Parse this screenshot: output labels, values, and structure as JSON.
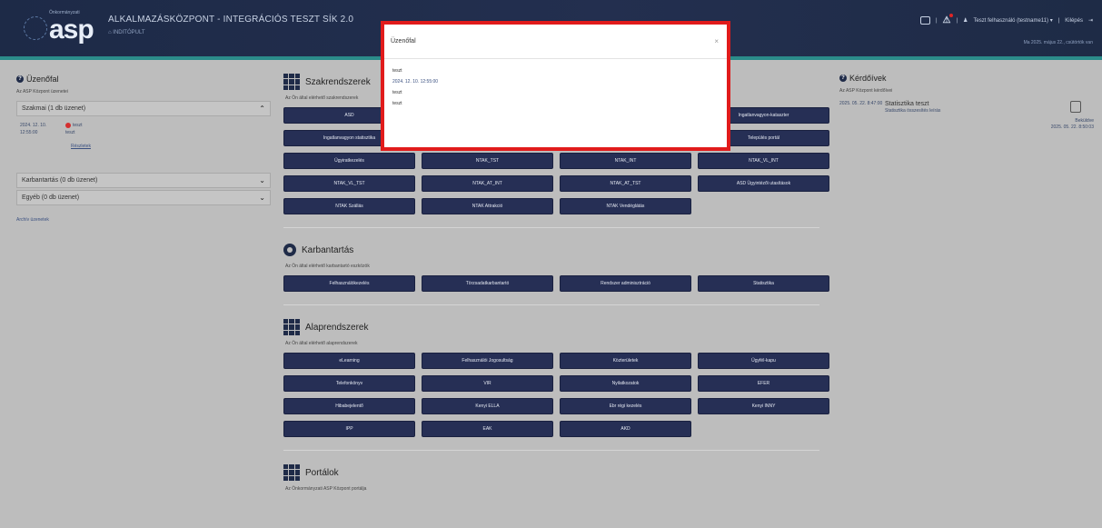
{
  "header": {
    "logo_small": "Önkormányzati",
    "logo_text": "asp",
    "title": "ALKALMAZÁSKÖZPONT - INTEGRÁCIÓS TESZT SÍK 2.0",
    "breadcrumb": "⌂ INDITÓPULT",
    "user": "Teszt felhasználó (testname11) ▾",
    "logout": "Kilépés",
    "date_line": "Ma 2025. május 22., csütörtök van"
  },
  "left": {
    "title": "Üzenőfal",
    "subtitle": "Az ASP Központ üzenetei",
    "acc1": "Szakmai (1 db üzenet)",
    "msg_date": "2024. 12. 10. 12:55:00",
    "msg_title": "teszt",
    "msg_body": "teszt",
    "details": "Részletek",
    "acc2": "Karbantartás (0 db üzenet)",
    "acc3": "Egyéb (0 db üzenet)",
    "archive": "Archív üzenetek"
  },
  "center": {
    "sec1_title": "Szakrendszerek",
    "sec1_sub": "Az Ön által elérhető szakrendszerek",
    "sec1_buttons": [
      "ASD",
      "",
      "",
      "Ingatlanvagyon-kataszter",
      "Ingatlanvagyon statisztika",
      "",
      "",
      "Település portál",
      "Ügyiratkezelés",
      "NTAK_TST",
      "NTAK_INT",
      "NTAK_VL_INT",
      "NTAK_VL_TST",
      "NTAK_AT_INT",
      "NTAK_AT_TST",
      "ASD Ügyintézői utasítások",
      "NTAK Szállás",
      "NTAK Attrakció",
      "NTAK Vendéglátás"
    ],
    "sec2_title": "Karbantartás",
    "sec2_sub": "Az Ön által elérhető karbantartó eszközök",
    "sec2_buttons": [
      "Felhasználókezelés",
      "Törzsadatkarbantartó",
      "Rendszer adminisztráció",
      "Statisztika"
    ],
    "sec3_title": "Alaprendszerek",
    "sec3_sub": "Az Ön által elérhető alaprendszerek",
    "sec3_buttons": [
      "eLearning",
      "Felhasználói Jogosultság",
      "Közterületek",
      "Ügyfél-kapu",
      "Telefonkönyv",
      "VIR",
      "Nyilatkozatok",
      "EFER",
      "Hibabejelentő",
      "Kenyi ELLA",
      "Ebr régi kezelés",
      "Kenyi INNY",
      "IPP",
      "EAK",
      "AKD"
    ],
    "sec4_title": "Portálok",
    "sec4_sub": "Az Önkormányzati ASP Központ portálja"
  },
  "right": {
    "title": "Kérdőívek",
    "subtitle": "Az ASP Központ kérdőívei",
    "date": "2025. 05. 22. 8:47:00",
    "survey_title": "Statisztika teszt",
    "survey_desc": "Statisztika összesítés leírás",
    "action_label": "Beküldve",
    "action_date": "2025. 05. 22. 8:50:03"
  },
  "modal": {
    "title": "Üzenőfal",
    "close": "×",
    "line1": "teszt",
    "timestamp": "2024. 12. 10. 12:55:00",
    "line2": "teszt",
    "line3": "teszt"
  }
}
